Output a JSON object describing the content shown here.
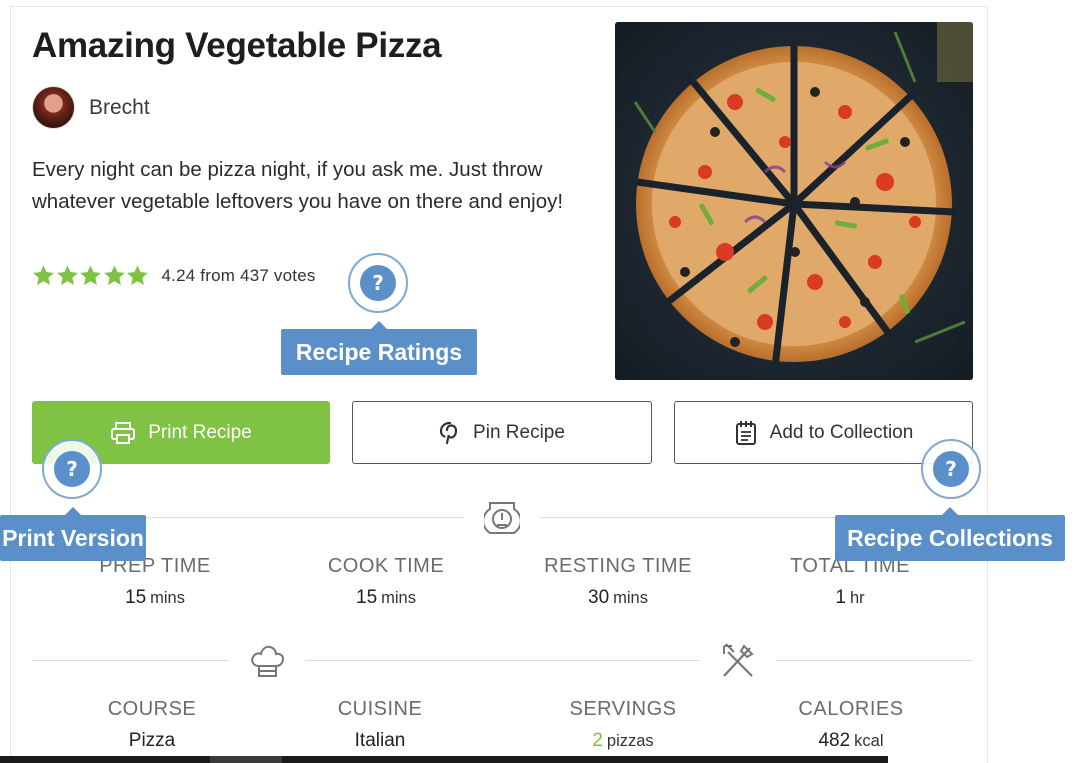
{
  "recipe": {
    "title": "Amazing Vegetable Pizza",
    "author": "Brecht",
    "summary": "Every night can be pizza night, if you ask me. Just throw whatever vegetable leftovers you have on there and enjoy!",
    "rating": {
      "stars": 5,
      "text": "4.24 from 437 votes",
      "star_color": "#7fc244"
    }
  },
  "buttons": {
    "print": "Print Recipe",
    "pin": "Pin Recipe",
    "collection": "Add to Collection"
  },
  "times": [
    {
      "label": "PREP TIME",
      "value": "15",
      "unit": "mins"
    },
    {
      "label": "COOK TIME",
      "value": "15",
      "unit": "mins"
    },
    {
      "label": "RESTING TIME",
      "value": "30",
      "unit": "mins"
    },
    {
      "label": "TOTAL TIME",
      "value": "1",
      "unit": "hr"
    }
  ],
  "details": [
    {
      "label": "COURSE",
      "value": "Pizza"
    },
    {
      "label": "CUISINE",
      "value": "Italian"
    },
    {
      "label": "SERVINGS",
      "value": "2",
      "unit": "pizzas"
    },
    {
      "label": "CALORIES",
      "value": "482",
      "unit": "kcal"
    }
  ],
  "tooltips": {
    "ratings": "Recipe Ratings",
    "print": "Print Version",
    "collections": "Recipe Collections",
    "help_glyph": "?"
  },
  "colors": {
    "accent_green": "#7fc244",
    "tooltip_blue": "#5b8fc9"
  }
}
